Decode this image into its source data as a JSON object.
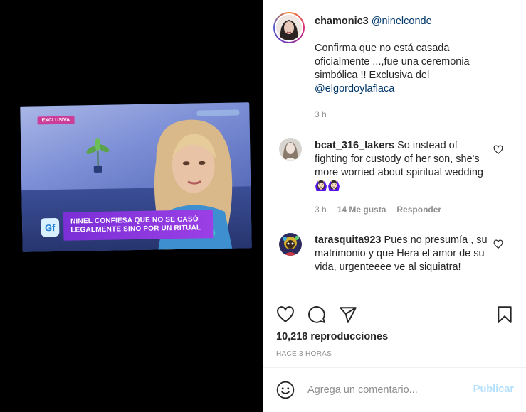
{
  "media": {
    "badge": "EXCLUSIVA",
    "lower_third_line1": "NINEL CONFIESA QUE NO SE CASÓ",
    "lower_third_line2": "LEGALMENTE SINO POR UN RITUAL",
    "show_logo": "Gf"
  },
  "post": {
    "author": "chamonic3",
    "mention": "@ninelconde",
    "caption": "Confirma que no está casada oficialmente ...,fue una ceremonia simbólica !! Exclusiva del",
    "caption_mention": "@elgordoylaflaca",
    "time": "3 h"
  },
  "comments": [
    {
      "username": "bcat_316_lakers",
      "text": "So instead of fighting for custody of her son, she's more worried about spiritual wedding 🙆🏻‍♀️🙆🏻‍♀️",
      "time": "3 h",
      "likes": "14 Me gusta",
      "reply": "Responder"
    },
    {
      "username": "tarasquita923",
      "text": "Pues no presumía , su matrimonio y que Hera el amor de su vida, urgenteeee ve al siquiatra!"
    }
  ],
  "stats": {
    "views": "10,218 reproducciones",
    "posted": "HACE 3 HORAS"
  },
  "composer": {
    "placeholder": "Agrega un comentario...",
    "post_label": "Publicar"
  },
  "icons": {
    "like": "heart-icon",
    "comment": "comment-icon",
    "share": "share-icon",
    "save": "bookmark-icon",
    "emoji": "emoji-icon"
  },
  "colors": {
    "link": "#00376b",
    "muted": "#8e8e8e",
    "post_button": "#b2dffc"
  }
}
